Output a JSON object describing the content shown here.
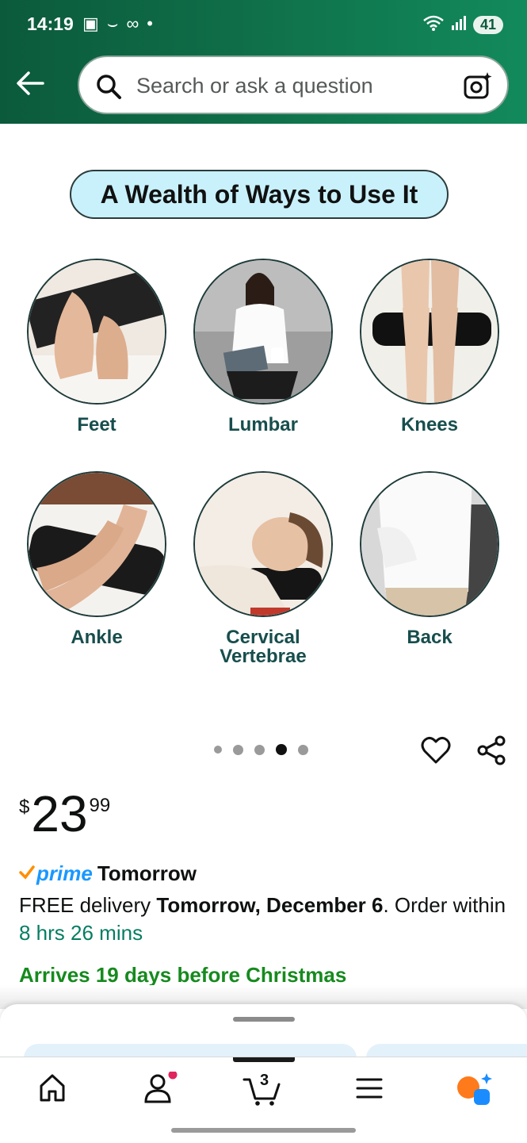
{
  "status_bar": {
    "time": "14:19",
    "battery": "41"
  },
  "search": {
    "placeholder": "Search or ask a question"
  },
  "product_image": {
    "banner": "A Wealth of Ways to Use It",
    "uses": [
      {
        "label": "Feet"
      },
      {
        "label": "Lumbar"
      },
      {
        "label": "Knees"
      },
      {
        "label": "Ankle"
      },
      {
        "label": "Cervical\nVertebrae"
      },
      {
        "label": "Back"
      }
    ],
    "carousel": {
      "count": 5,
      "active_index": 3
    }
  },
  "price": {
    "symbol": "$",
    "whole": "23",
    "fraction": "99"
  },
  "delivery": {
    "prime_label": "prime",
    "prime_day": "Tomorrow",
    "line_prefix": "FREE delivery ",
    "date": "Tomorrow, December 6",
    "line_mid": ". Order within ",
    "countdown": "8 hrs 26 mins",
    "christmas_note": "Arrives 19 days before Christmas"
  },
  "bottom_nav": {
    "cart_count": "3"
  },
  "colors": {
    "header_green": "#0f6e48",
    "prime_blue": "#1a98ff",
    "christmas_green": "#168a1e",
    "countdown_teal": "#067d62"
  }
}
